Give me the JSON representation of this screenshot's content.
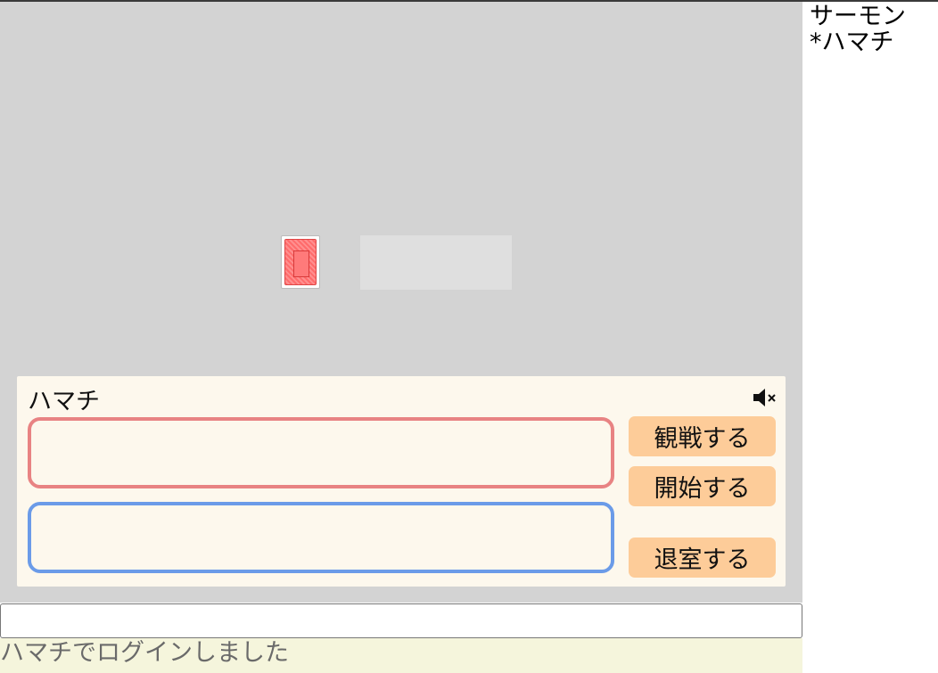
{
  "members": [
    "サーモン",
    "*ハマチ"
  ],
  "player": {
    "name": "ハマチ",
    "mute_icon": "speaker-muted-icon"
  },
  "buttons": {
    "watch": "観戦する",
    "start": "開始する",
    "leave": "退室する"
  },
  "chat": {
    "value": "",
    "placeholder": ""
  },
  "log": [
    "ハマチでログインしました"
  ],
  "deck": {
    "card_back_icon": "card-back-icon"
  },
  "colors": {
    "table": "#d3d3d3",
    "panel": "#fdf8ed",
    "button": "#fdcc99",
    "hand_red": "#e88383",
    "hand_blue": "#6b9be8",
    "log_bg": "#f5f5dc"
  }
}
